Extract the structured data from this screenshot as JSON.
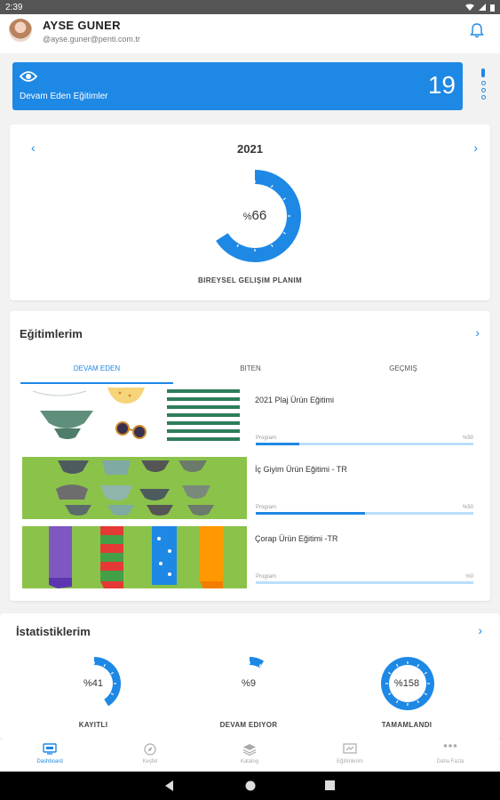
{
  "status": {
    "time": "2:39"
  },
  "user": {
    "name": "AYSE GUNER",
    "email": "@ayse.guner@penti.com.tr"
  },
  "banner": {
    "label": "Devam Eden Eğitimler",
    "count": "19"
  },
  "plan": {
    "year": "2021",
    "percent_prefix": "%",
    "percent_value": "66",
    "percent": 66,
    "caption": "BIREYSEL GELIŞIM PLANIM"
  },
  "trainings": {
    "title": "Eğitimlerim",
    "tabs": [
      {
        "label": "DEVAM EDEN"
      },
      {
        "label": "BITEN"
      },
      {
        "label": "GEÇMIŞ"
      }
    ],
    "courses": [
      {
        "name": "2021 Plaj Ürün Eğitimi",
        "program_label": "Program",
        "progress_text": "%50",
        "progress": 0.2
      },
      {
        "name": "İç Giyim Ürün Eğitimi - TR",
        "program_label": "Program",
        "progress_text": "%50",
        "progress": 0.5
      },
      {
        "name": "Çorap Ürün Eğitimi -TR",
        "program_label": "Program",
        "progress_text": "%0",
        "progress": 0
      }
    ]
  },
  "stats": {
    "title": "İstatistiklerim",
    "items": [
      {
        "value": "%41",
        "label": "KAYITLI",
        "percent": 41
      },
      {
        "value": "%9",
        "label": "DEVAM EDIYOR",
        "percent": 9
      },
      {
        "value": "%158",
        "label": "TAMAMLANDI",
        "percent": 100
      }
    ]
  },
  "nav": [
    {
      "label": "Dashboard",
      "icon": "dashboard-icon"
    },
    {
      "label": "Keşfet",
      "icon": "compass-icon"
    },
    {
      "label": "Katalog",
      "icon": "layers-icon"
    },
    {
      "label": "Eğitimlerim",
      "icon": "trainings-icon"
    },
    {
      "label": "Daha Fazla",
      "icon": "more-icon"
    }
  ],
  "colors": {
    "accent": "#1e88e5",
    "accent_light": "#bbdefb"
  }
}
